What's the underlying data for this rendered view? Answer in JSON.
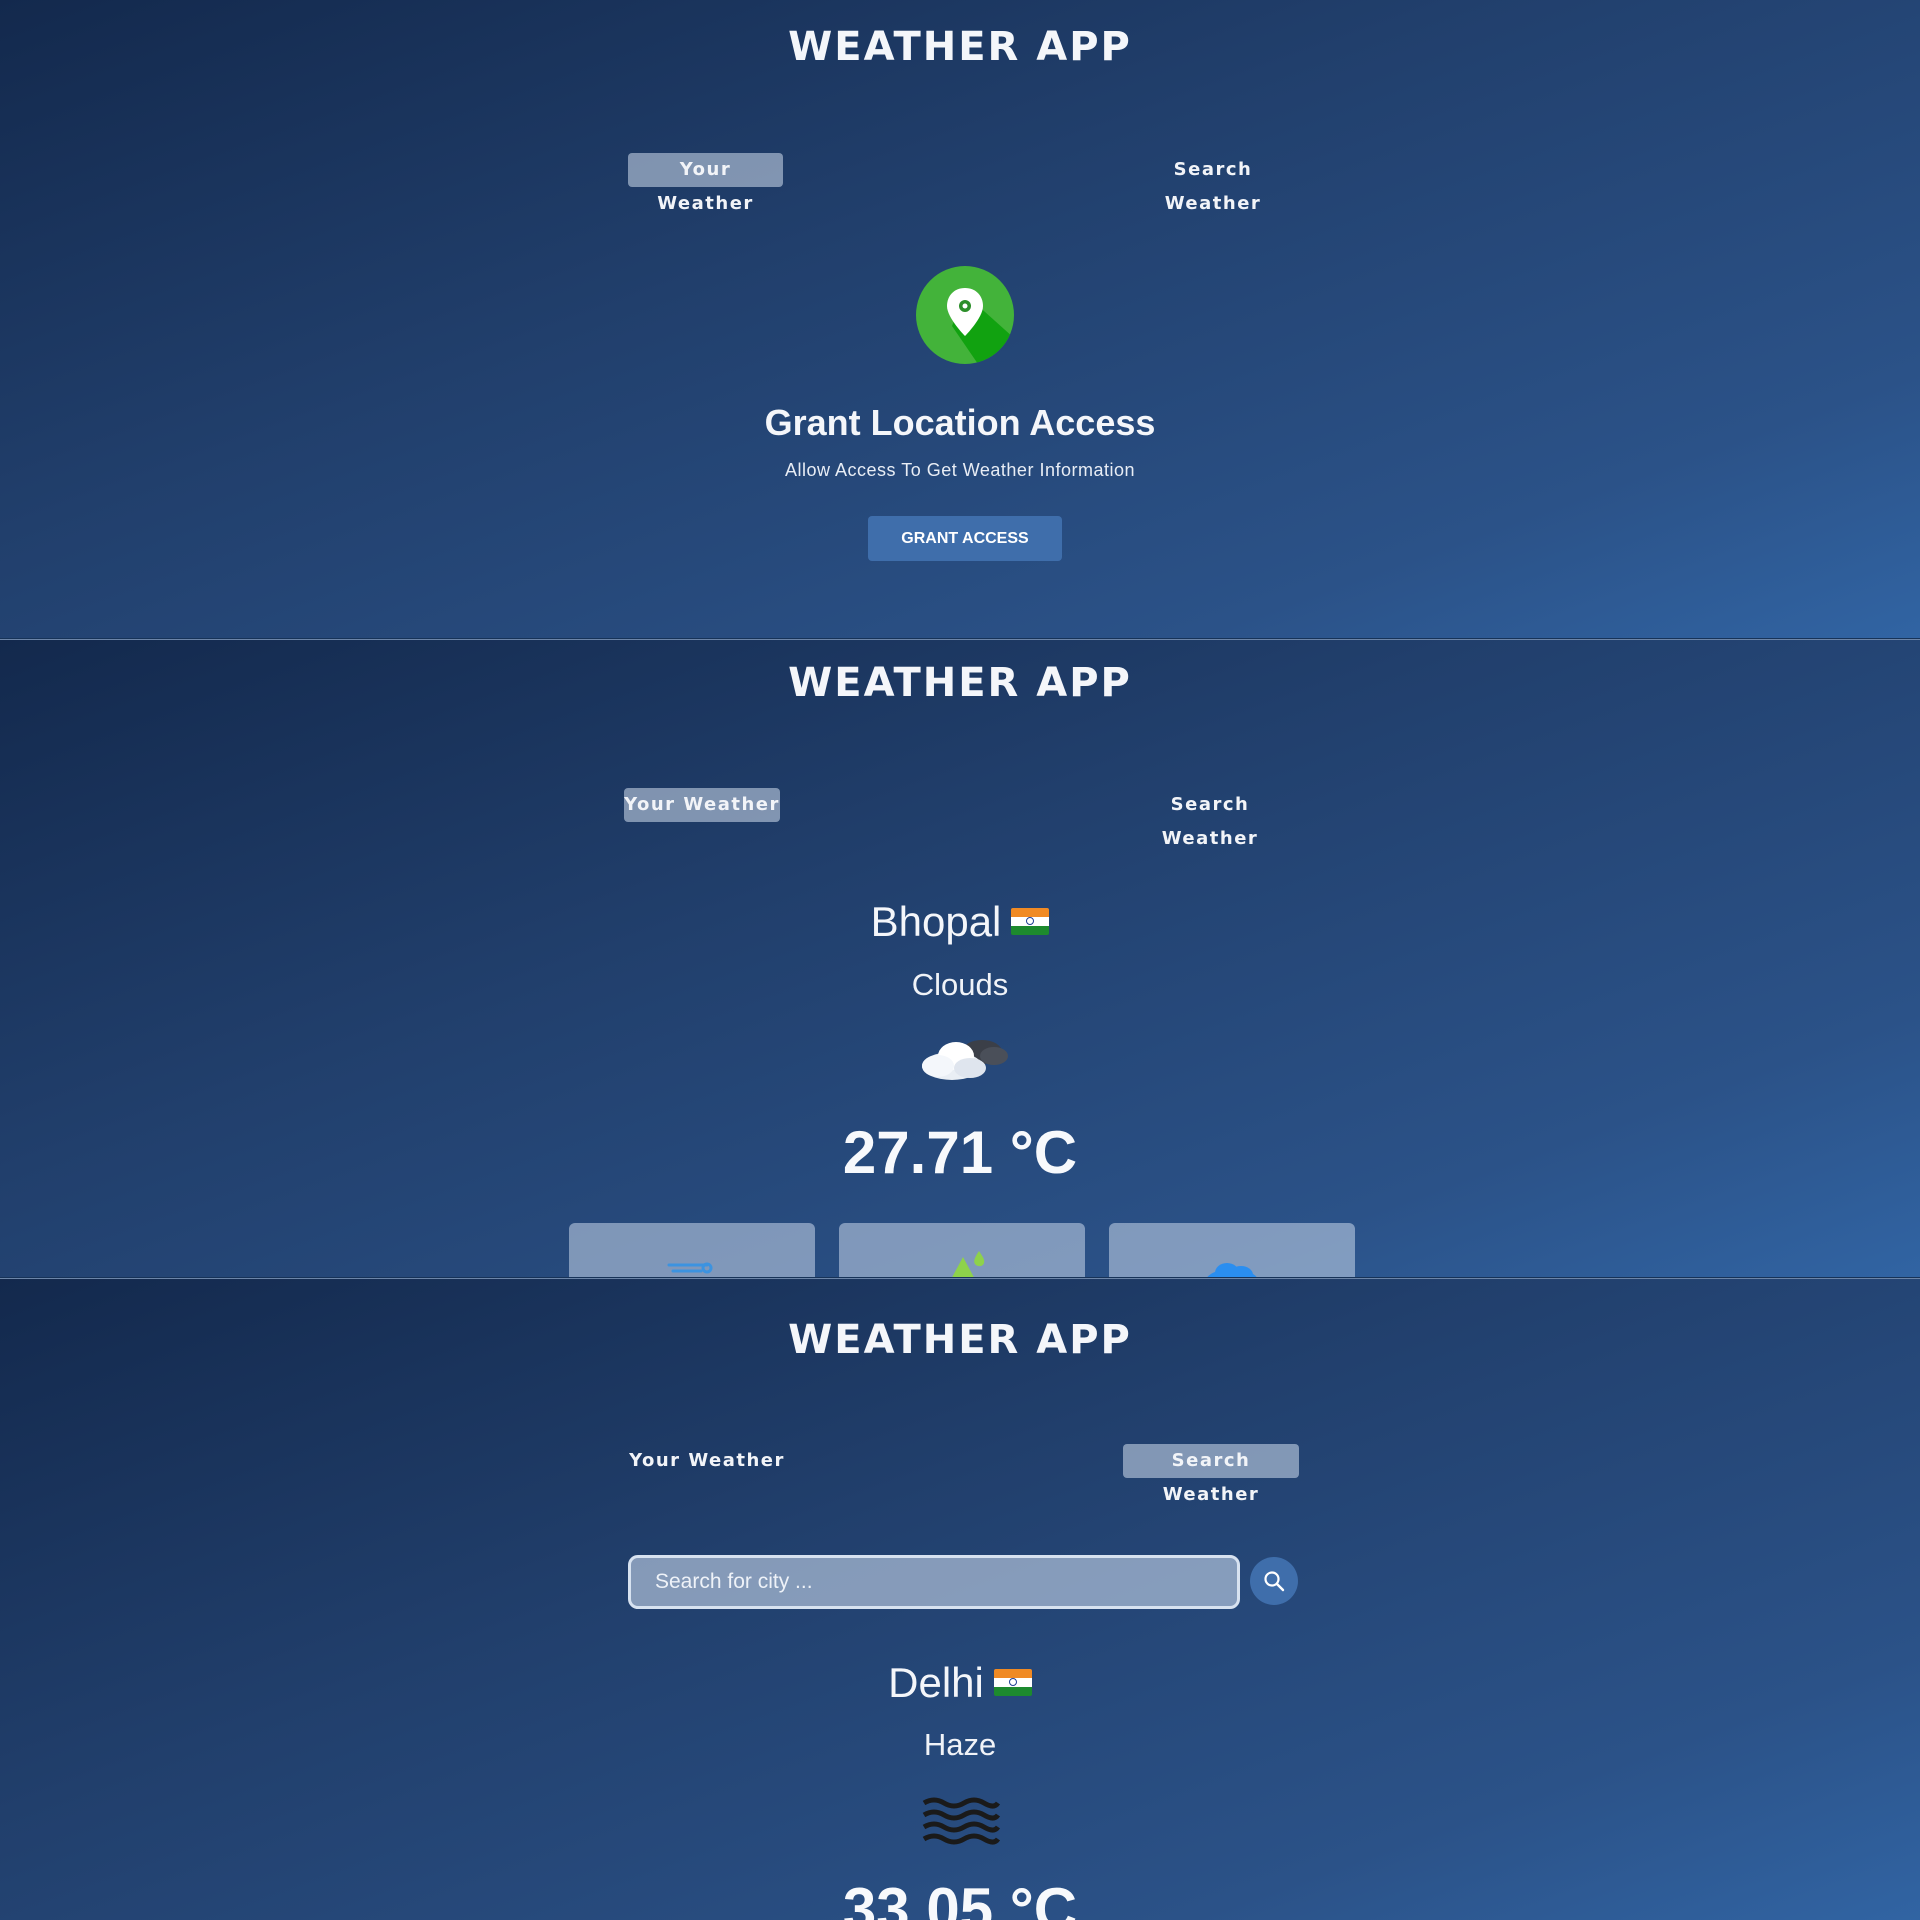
{
  "app_title": "WEATHER APP",
  "tabs": {
    "your_weather": "Your Weather",
    "search_weather": "Search Weather"
  },
  "grant_screen": {
    "title": "Grant Location Access",
    "subtitle": "Allow Access To Get Weather Information",
    "button": "GRANT ACCESS",
    "icon": "location-pin-icon"
  },
  "your_weather_screen": {
    "city": "Bhopal",
    "flag": "india-flag-icon",
    "description": "Clouds",
    "weather_icon": "cloud-icon",
    "temperature": "27.71 °C",
    "parameters": [
      {
        "icon": "wind-icon"
      },
      {
        "icon": "humidity-icon"
      },
      {
        "icon": "cloudiness-icon"
      }
    ]
  },
  "search_screen": {
    "search": {
      "placeholder": "Search for city ...",
      "value": ""
    },
    "search_icon": "search-icon",
    "city": "Delhi",
    "flag": "india-flag-icon",
    "description": "Haze",
    "weather_icon": "haze-icon",
    "temperature": "33.05 °C"
  },
  "colors": {
    "background_dark": "#13294d",
    "background_light": "#3164a3",
    "button": "#3f6eab",
    "pin_green": "#43b33a"
  }
}
